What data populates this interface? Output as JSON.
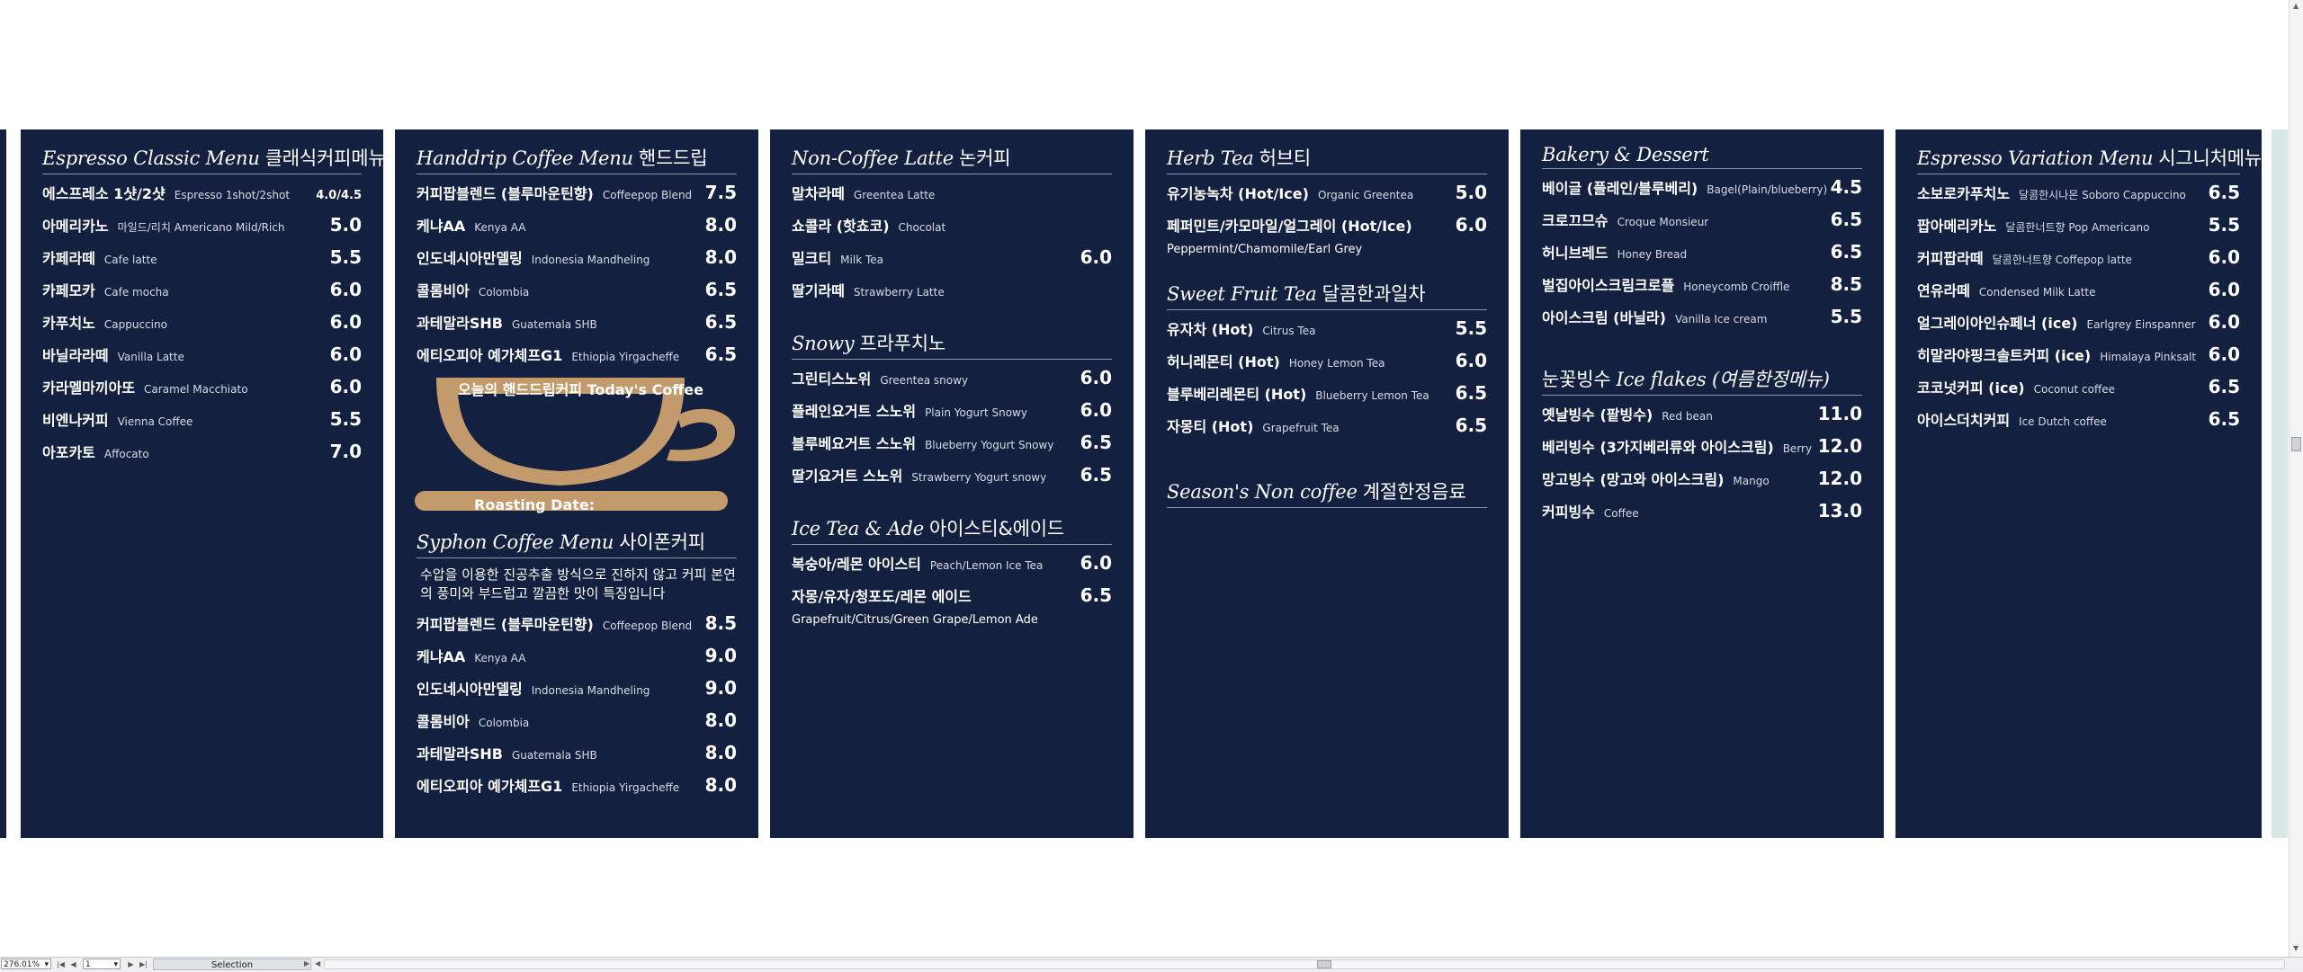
{
  "panels": {
    "classic": {
      "sections": [
        {
          "title_en": "Espresso Classic Menu",
          "title_ko": "클래식커피메뉴",
          "items": [
            {
              "kr": "에스프레소 1샷/2샷",
              "en": "Espresso 1shot/2shot",
              "price": "4.0/4.5"
            },
            {
              "kr": "아메리카노",
              "en": "마일드/리치 Americano Mild/Rich",
              "price": "5.0"
            },
            {
              "kr": "카페라떼",
              "en": "Cafe latte",
              "price": "5.5"
            },
            {
              "kr": "카페모카",
              "en": "Cafe mocha",
              "price": "6.0"
            },
            {
              "kr": "카푸치노",
              "en": "Cappuccino",
              "price": "6.0"
            },
            {
              "kr": "바닐라라떼",
              "en": "Vanilla Latte",
              "price": "6.0"
            },
            {
              "kr": "카라멜마끼아또",
              "en": "Caramel Macchiato",
              "price": "6.0"
            },
            {
              "kr": "비엔나커피",
              "en": "Vienna Coffee",
              "price": "5.5"
            },
            {
              "kr": "아포카토",
              "en": "Affocato",
              "price": "7.0"
            }
          ]
        }
      ]
    },
    "handdrip": {
      "sections": [
        {
          "title_en": "Handdrip Coffee Menu",
          "title_ko": "핸드드립",
          "items": [
            {
              "kr": "커피팝블렌드 (블루마운틴향)",
              "en": "Coffeepop Blend",
              "price": "7.5"
            },
            {
              "kr": "케냐AA",
              "en": "Kenya AA",
              "price": "8.0"
            },
            {
              "kr": "인도네시아만델링",
              "en": "Indonesia Mandheling",
              "price": "8.0"
            },
            {
              "kr": "콜롬비아",
              "en": "Colombia",
              "price": "6.5"
            },
            {
              "kr": "과테말라SHB",
              "en": "Guatemala SHB",
              "price": "6.5"
            },
            {
              "kr": "에티오피아 예가체프G1",
              "en": "Ethiopia Yirgacheffe",
              "price": "6.5"
            }
          ]
        },
        {
          "title_en": "Syphon Coffee Menu",
          "title_ko": "사이폰커피",
          "description": "수압을 이용한 진공추출 방식으로 진하지 않고 커피 본연의 풍미와 부드럽고 깔끔한 맛이 특징입니다",
          "items": [
            {
              "kr": "커피팝블렌드 (블루마운틴향)",
              "en": "Coffeepop Blend",
              "price": "8.5"
            },
            {
              "kr": "케냐AA",
              "en": "Kenya AA",
              "price": "9.0"
            },
            {
              "kr": "인도네시아만델링",
              "en": "Indonesia Mandheling",
              "price": "9.0"
            },
            {
              "kr": "콜롬비아",
              "en": "Colombia",
              "price": "8.0"
            },
            {
              "kr": "과테말라SHB",
              "en": "Guatemala SHB",
              "price": "8.0"
            },
            {
              "kr": "에티오피아 예가체프G1",
              "en": "Ethiopia Yirgacheffe",
              "price": "8.0"
            }
          ]
        }
      ],
      "today_coffee": "오늘의 핸드드립커피 Today's Coffee",
      "roasting_date": "Roasting Date:",
      "cup_color": "#c29a6b"
    },
    "noncoffee": {
      "sections": [
        {
          "title_en": "Non-Coffee Latte",
          "title_ko": "논커피",
          "items": [
            {
              "kr": "말차라떼",
              "en": "Greentea Latte",
              "price": ""
            },
            {
              "kr": "쇼콜라 (핫쵸코)",
              "en": "Chocolat",
              "price": ""
            },
            {
              "kr": "밀크티",
              "en": "Milk Tea",
              "price": "6.0"
            },
            {
              "kr": "딸기라떼",
              "en": "Strawberry Latte",
              "price": ""
            }
          ]
        },
        {
          "title_en": "Snowy",
          "title_ko": "프라푸치노",
          "items": [
            {
              "kr": "그린티스노위",
              "en": "Greentea snowy",
              "price": "6.0"
            },
            {
              "kr": "플레인요거트 스노위",
              "en": "Plain Yogurt Snowy",
              "price": "6.0"
            },
            {
              "kr": "블루베요거트 스노위",
              "en": "Blueberry Yogurt Snowy",
              "price": "6.5"
            },
            {
              "kr": "딸기요거트 스노위",
              "en": "Strawberry Yogurt snowy",
              "price": "6.5"
            }
          ]
        },
        {
          "title_en": "Ice Tea & Ade",
          "title_ko": "아이스티&에이드",
          "items": [
            {
              "kr": "복숭아/레몬 아이스티",
              "en": "Peach/Lemon Ice Tea",
              "price": "6.0"
            },
            {
              "kr": "자몽/유자/청포도/레몬 에이드",
              "en": "",
              "price": "6.5",
              "sub": "Grapefruit/Citrus/Green Grape/Lemon Ade"
            }
          ]
        }
      ]
    },
    "tea": {
      "sections": [
        {
          "title_en": "Herb Tea",
          "title_ko": "허브티",
          "items": [
            {
              "kr": "유기농녹차 (Hot/Ice)",
              "en": "Organic Greentea",
              "price": "5.0"
            },
            {
              "kr": "페퍼민트/카모마일/얼그레이 (Hot/Ice)",
              "en": "",
              "price": "6.0",
              "sub": "Peppermint/Chamomile/Earl Grey"
            }
          ]
        },
        {
          "title_en": "Sweet Fruit Tea",
          "title_ko": "달콤한과일차",
          "items": [
            {
              "kr": "유자차 (Hot)",
              "en": "Citrus Tea",
              "price": "5.5"
            },
            {
              "kr": "허니레몬티 (Hot)",
              "en": "Honey Lemon Tea",
              "price": "6.0"
            },
            {
              "kr": "블루베리레몬티 (Hot)",
              "en": "Blueberry Lemon Tea",
              "price": "6.5"
            },
            {
              "kr": "자몽티 (Hot)",
              "en": "Grapefruit Tea",
              "price": "6.5"
            }
          ]
        },
        {
          "title_en": "Season's Non coffee",
          "title_ko": "계절한정음료",
          "items": []
        }
      ]
    },
    "bakery": {
      "sections": [
        {
          "title_en": "Bakery & Dessert",
          "title_ko": "",
          "items": [
            {
              "kr": "베이글 (플레인/블루베리)",
              "en": "Bagel(Plain/blueberry)",
              "price": "4.5"
            },
            {
              "kr": "크로끄므슈",
              "en": "Croque Monsieur",
              "price": "6.5"
            },
            {
              "kr": "허니브레드",
              "en": "Honey Bread",
              "price": "6.5"
            },
            {
              "kr": "벌집아이스크림크로플",
              "en": "Honeycomb Croiffle",
              "price": "8.5"
            },
            {
              "kr": "아이스크림 (바닐라)",
              "en": "Vanilla Ice cream",
              "price": "5.5"
            }
          ]
        },
        {
          "title_en": "Ice flakes (여름한정메뉴)",
          "title_ko_prefix": "눈꽃빙수",
          "title_ko": "",
          "items": [
            {
              "kr": "옛날빙수 (팥빙수)",
              "en": "Red bean",
              "price": "11.0"
            },
            {
              "kr": "베리빙수 (3가지베리류와 아이스크림)",
              "en": "Berry",
              "price": "12.0"
            },
            {
              "kr": "망고빙수 (망고와 아이스크림)",
              "en": "Mango",
              "price": "12.0"
            },
            {
              "kr": "커피빙수",
              "en": "Coffee",
              "price": "13.0"
            }
          ]
        }
      ]
    },
    "variation": {
      "sections": [
        {
          "title_en": "Espresso Variation Menu",
          "title_ko": "시그니처메뉴",
          "items": [
            {
              "kr": "소보로카푸치노",
              "en": "달콤한시나몬 Soboro Cappuccino",
              "price": "6.5"
            },
            {
              "kr": "팝아메리카노",
              "en": "달콤한너트향 Pop Americano",
              "price": "5.5"
            },
            {
              "kr": "커피팝라떼",
              "en": "달콤한너트향 Coffepop latte",
              "price": "6.0"
            },
            {
              "kr": "연유라떼",
              "en": "Condensed Milk Latte",
              "price": "6.0"
            },
            {
              "kr": "얼그레이아인슈페너 (ice)",
              "en": "Earlgrey Einspanner",
              "price": "6.0"
            },
            {
              "kr": "히말라야핑크솔트커피 (ice)",
              "en": "Himalaya Pinksalt",
              "price": "6.0"
            },
            {
              "kr": "코코넛커피 (ice)",
              "en": "Coconut coffee",
              "price": "6.5"
            },
            {
              "kr": "아이스더치커피",
              "en": "Ice Dutch coffee",
              "price": "6.5"
            }
          ]
        }
      ]
    }
  },
  "statusbar": {
    "zoom": "276.01%",
    "page": "1",
    "mode": "Selection",
    "icons": [
      "first-page-icon",
      "prev-page-icon",
      "next-page-icon",
      "last-page-icon"
    ]
  },
  "colors": {
    "panel_bg": "#14203f",
    "cup": "#c29a6b",
    "page_bg": "#ffffff"
  }
}
